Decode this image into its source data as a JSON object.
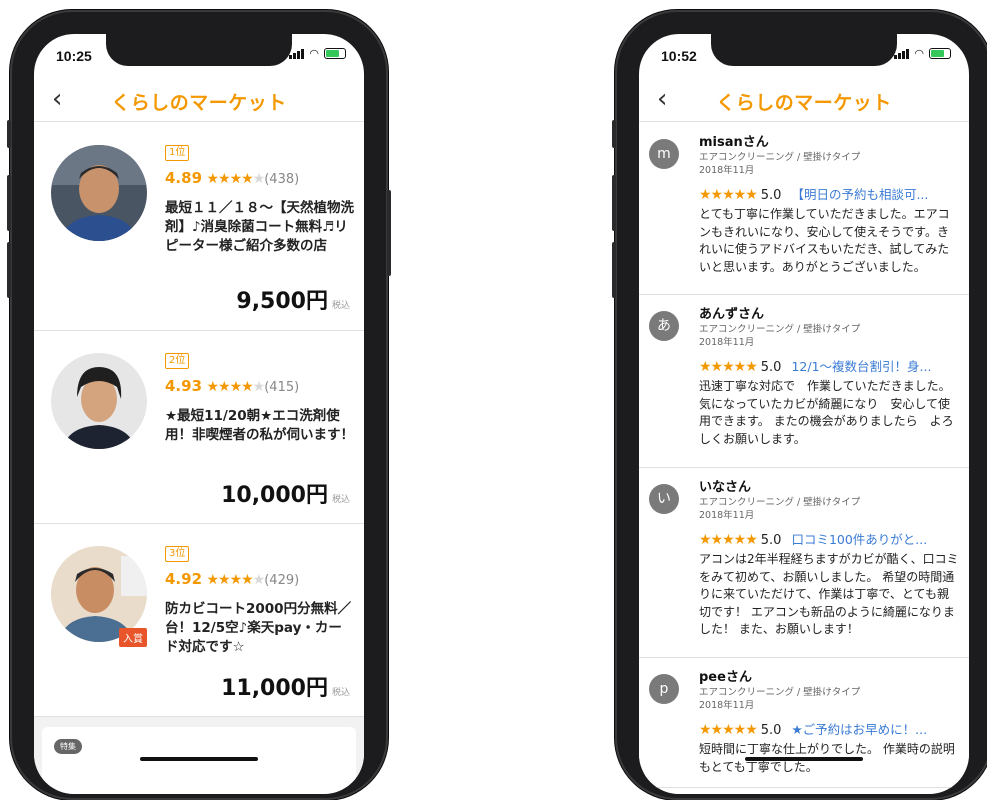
{
  "left_phone": {
    "status_time": "10:25",
    "logo": "くらしのマーケット",
    "back_icon": "‹",
    "ranking": [
      {
        "rank": "1位",
        "rating": "4.89",
        "stars_on": "★★★★",
        "stars_off": "★",
        "count": "(438)",
        "title": "最短１１／１８〜【天然植物洗剤】♪消臭除菌コート無料♬リピーター様ご紹介多数の店",
        "price": "9,500円",
        "tax": "税込"
      },
      {
        "rank": "2位",
        "rating": "4.93",
        "stars_on": "★★★★",
        "stars_off": "★",
        "count": "(415)",
        "title": "★最短11/20朝★エコ洗剤使用！非喫煙者の私が伺います！",
        "price": "10,000円",
        "tax": "税込"
      },
      {
        "rank": "3位",
        "rating": "4.92",
        "stars_on": "★★★★",
        "stars_off": "★",
        "count": "(429)",
        "title": "防カビコート2000円分無料／台！12/5空♪楽天pay・カード対応です☆",
        "price": "11,000円",
        "tax": "税込",
        "badge": "入賞"
      }
    ],
    "feature_tag": "特集"
  },
  "right_phone": {
    "status_time": "10:52",
    "logo": "くらしのマーケット",
    "back_icon": "‹",
    "reviews": [
      {
        "initial": "m",
        "name": "misanさん",
        "category": "エアコンクリーニング / 壁掛けタイプ",
        "date": "2018年11月",
        "stars": "★★★★★",
        "score": "5.0",
        "link": "【明日の予約も相談可...",
        "text": "とても丁寧に作業していただきました。エアコンもきれいになり、安心して使えそうです。きれいに使うアドバイスもいただき、試してみたいと思います。ありがとうございました。"
      },
      {
        "initial": "あ",
        "name": "あんずさん",
        "category": "エアコンクリーニング / 壁掛けタイプ",
        "date": "2018年11月",
        "stars": "★★★★★",
        "score": "5.0",
        "link": "12/1〜複数台割引！身...",
        "text": "迅速丁寧な対応で　作業していただきました。気になっていたカビが綺麗になり　安心して使用できます。 またの機会がありましたら　よろしくお願いします。"
      },
      {
        "initial": "い",
        "name": "いなさん",
        "category": "エアコンクリーニング / 壁掛けタイプ",
        "date": "2018年11月",
        "stars": "★★★★★",
        "score": "5.0",
        "link": "口コミ100件ありがと...",
        "text": "アコンは2年半程経ちますがカビが酷く、口コミをみて初めて、お願いしました。 希望の時間通りに来ていただけて、作業は丁寧で、とても親切です！ エアコンも新品のように綺麗になりました！ また、お願いします！"
      },
      {
        "initial": "p",
        "name": "peeさん",
        "category": "エアコンクリーニング / 壁掛けタイプ",
        "date": "2018年11月",
        "stars": "★★★★★",
        "score": "5.0",
        "link": "★ご予約はお早めに！...",
        "text": "短時間に丁寧な仕上がりでした。 作業時の説明もとても丁寧でした。"
      }
    ]
  }
}
